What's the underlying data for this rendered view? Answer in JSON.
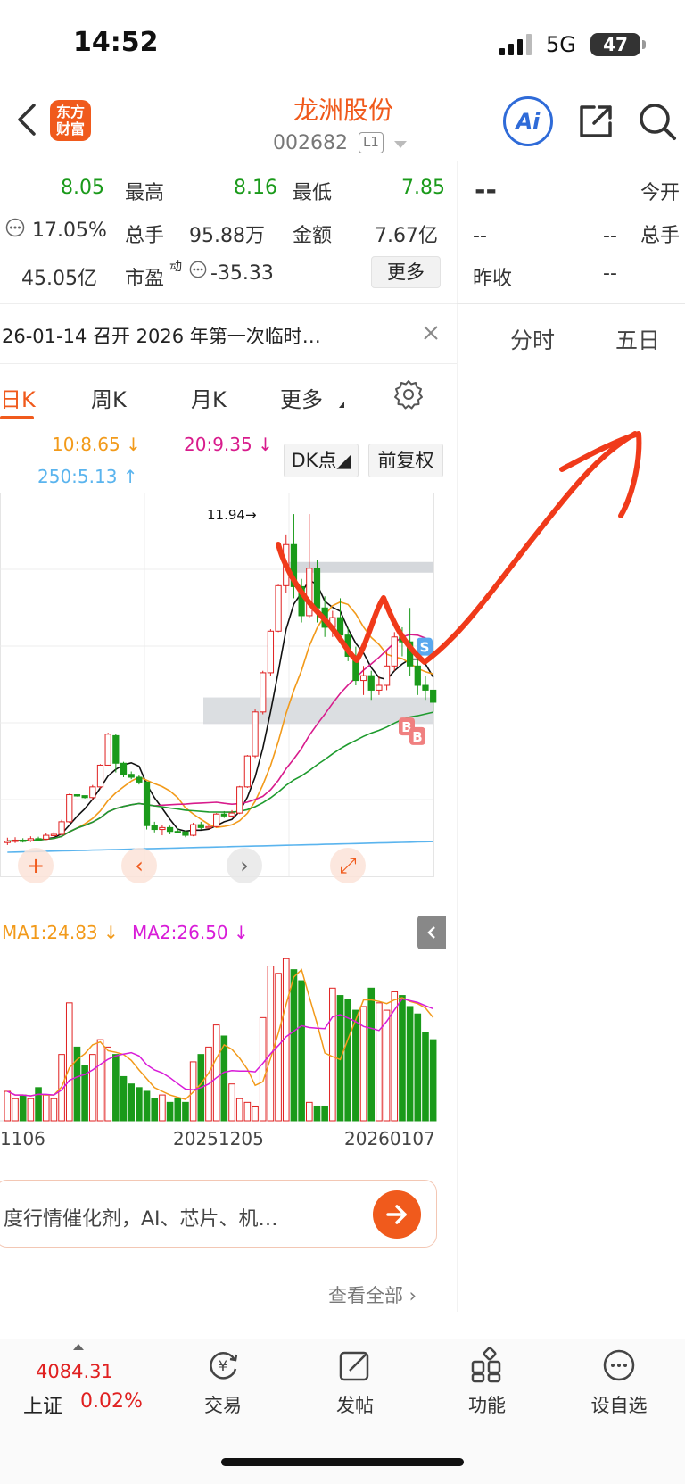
{
  "status_bar": {
    "time": "14:52",
    "network": "5G",
    "battery": "47"
  },
  "header": {
    "stock_name": "龙洲股份",
    "stock_code": "002682",
    "level_badge": "L1",
    "logo_text": "东方财富",
    "ai_label": "Ai"
  },
  "quote": {
    "rows": [
      {
        "v1": "8.05",
        "k2": "最高",
        "v2": "8.16",
        "k3": "最低",
        "v3": "7.85"
      },
      {
        "v1": "17.05%",
        "k2": "总手",
        "v2": "95.88万",
        "k3": "金额",
        "v3": "7.67亿"
      },
      {
        "v1": "45.05亿",
        "k2": "市盈",
        "k2_sup": "动",
        "v2": "-35.33"
      }
    ],
    "more_label": "更多"
  },
  "right_panel": {
    "price": "--",
    "open_label": "今开",
    "row2_a": "--",
    "row2_b": "--",
    "volume_label": "总手",
    "prev_close_label": "昨收",
    "prev_close_value": "--",
    "tabs": [
      "分时",
      "五日"
    ]
  },
  "notice": {
    "text": "26-01-14 召开 2026 年第一次临时…"
  },
  "ktabs": {
    "day": "日K",
    "week": "周K",
    "month": "月K",
    "more": "更多"
  },
  "ma_legend": {
    "ma10": "10:8.65",
    "ma20": "20:9.35",
    "ma250": "250:5.13",
    "dk_label": "DK点",
    "adjust_label": "前复权",
    "colors": {
      "ma10": "#f29a1a",
      "ma20": "#d81b8c",
      "ma250": "#5ab4ee",
      "ma5": "#111111",
      "ma60": "#1e9b2e"
    }
  },
  "chart_data": {
    "type": "candlestick",
    "price_high_label": "11.94",
    "signal_labels": [
      "S",
      "B",
      "B"
    ],
    "x_labels": [
      "1106",
      "20251205",
      "20260107"
    ],
    "volume_legend": {
      "ma1": "MA1:24.83",
      "ma2": "MA2:26.50"
    },
    "candles": [
      [
        5.15,
        5.18,
        5.25,
        5.1
      ],
      [
        5.18,
        5.2,
        5.26,
        5.14
      ],
      [
        5.2,
        5.19,
        5.24,
        5.15
      ],
      [
        5.19,
        5.23,
        5.28,
        5.16
      ],
      [
        5.23,
        5.22,
        5.27,
        5.18
      ],
      [
        5.22,
        5.3,
        5.34,
        5.2
      ],
      [
        5.3,
        5.32,
        5.38,
        5.26
      ],
      [
        5.32,
        5.58,
        5.62,
        5.3
      ],
      [
        5.58,
        6.14,
        6.16,
        5.56
      ],
      [
        6.14,
        6.12,
        6.14,
        6.1
      ],
      [
        6.12,
        6.08,
        6.1,
        6.06
      ],
      [
        6.08,
        6.3,
        6.34,
        6.02
      ],
      [
        6.3,
        6.75,
        6.77,
        6.26
      ],
      [
        6.75,
        7.39,
        7.42,
        6.74
      ],
      [
        7.36,
        6.79,
        7.4,
        6.6
      ],
      [
        6.79,
        6.56,
        6.82,
        6.5
      ],
      [
        6.56,
        6.5,
        6.62,
        6.46
      ],
      [
        6.5,
        6.4,
        6.55,
        6.35
      ],
      [
        6.4,
        5.5,
        6.42,
        5.42
      ],
      [
        5.5,
        5.42,
        5.58,
        5.36
      ],
      [
        5.42,
        5.46,
        5.52,
        5.3
      ],
      [
        5.46,
        5.38,
        5.5,
        5.32
      ],
      [
        5.38,
        5.37,
        5.44,
        5.34
      ],
      [
        5.37,
        5.3,
        5.4,
        5.26
      ],
      [
        5.3,
        5.52,
        5.56,
        5.28
      ],
      [
        5.52,
        5.46,
        5.58,
        5.42
      ],
      [
        5.46,
        5.48,
        5.52,
        5.44
      ],
      [
        5.48,
        5.74,
        5.76,
        5.46
      ],
      [
        5.74,
        5.7,
        5.8,
        5.66
      ],
      [
        5.7,
        5.76,
        5.82,
        5.68
      ],
      [
        5.76,
        6.3,
        6.32,
        5.74
      ],
      [
        6.3,
        6.94,
        6.96,
        6.28
      ],
      [
        6.94,
        7.85,
        7.9,
        6.9
      ],
      [
        7.85,
        8.66,
        8.7,
        7.8
      ],
      [
        8.66,
        9.52,
        9.56,
        8.6
      ],
      [
        9.52,
        10.46,
        10.48,
        9.5
      ],
      [
        10.46,
        11.31,
        11.52,
        10.3
      ],
      [
        11.31,
        10.44,
        11.94,
        10.2
      ],
      [
        10.44,
        9.84,
        10.6,
        9.7
      ],
      [
        9.84,
        10.82,
        11.94,
        9.8
      ],
      [
        10.82,
        10.0,
        11.0,
        9.7
      ],
      [
        10.0,
        9.6,
        10.24,
        9.4
      ],
      [
        9.6,
        9.8,
        9.94,
        9.4
      ],
      [
        9.8,
        9.44,
        10.2,
        9.3
      ],
      [
        9.44,
        9.0,
        9.6,
        8.9
      ],
      [
        9.0,
        8.5,
        9.2,
        8.4
      ],
      [
        8.5,
        8.6,
        8.8,
        8.2
      ],
      [
        8.6,
        8.3,
        8.7,
        8.1
      ],
      [
        8.3,
        8.4,
        8.6,
        8.2
      ],
      [
        8.4,
        8.8,
        9.1,
        8.3
      ],
      [
        8.8,
        9.4,
        9.5,
        8.7
      ],
      [
        9.4,
        9.3,
        9.6,
        9.0
      ],
      [
        9.3,
        8.8,
        10.0,
        8.6
      ],
      [
        8.8,
        8.4,
        9.0,
        8.2
      ],
      [
        8.4,
        8.3,
        8.6,
        8.1
      ],
      [
        8.3,
        8.05,
        8.16,
        7.85
      ]
    ],
    "volume": [
      8,
      6,
      7,
      6,
      9,
      7,
      6,
      18,
      32,
      20,
      15,
      18,
      22,
      20,
      18,
      12,
      10,
      9,
      8,
      6,
      7,
      5,
      6,
      5,
      16,
      18,
      20,
      26,
      23,
      10,
      6,
      5,
      4,
      28,
      42,
      40,
      44,
      41,
      38,
      5,
      4,
      4,
      36,
      34,
      33,
      30,
      31,
      36,
      32,
      30,
      35,
      34,
      31,
      29,
      24,
      22
    ]
  },
  "ai_input": {
    "text": "度行情催化剂，AI、芯片、机…"
  },
  "view_all": {
    "label": "查看全部"
  },
  "bottom_nav": {
    "index_value": "4084.31",
    "index_name": "上证",
    "index_change": "0.02%",
    "items": [
      "交易",
      "发帖",
      "功能",
      "设自选"
    ]
  },
  "colors": {
    "accent": "#f05a1c",
    "up": "#e02020",
    "down": "#1a9a1a",
    "annotation": "#f03a1a"
  }
}
